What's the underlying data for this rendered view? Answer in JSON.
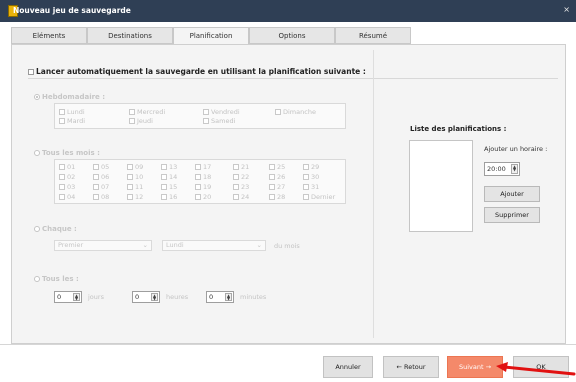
{
  "window": {
    "title": "Nouveau jeu de sauvegarde",
    "close_glyph": "×"
  },
  "tabs": [
    {
      "label": "Eléments"
    },
    {
      "label": "Destinations"
    },
    {
      "label": "Planification",
      "active": true
    },
    {
      "label": "Options"
    },
    {
      "label": "Résumé"
    }
  ],
  "auto_schedule": {
    "label": "Lancer automatiquement la sauvegarde en utilisant la planification suivante :",
    "checked": false
  },
  "weekly": {
    "label": "Hebdomadaire :",
    "days": [
      "Lundi",
      "Mercredi",
      "Vendredi",
      "Dimanche",
      "Mardi",
      "Jeudi",
      "Samedi"
    ]
  },
  "monthly": {
    "label": "Tous les mois :",
    "days": [
      "01",
      "05",
      "09",
      "13",
      "17",
      "21",
      "25",
      "29",
      "02",
      "06",
      "10",
      "14",
      "18",
      "22",
      "26",
      "30",
      "03",
      "07",
      "11",
      "15",
      "19",
      "23",
      "27",
      "31",
      "04",
      "08",
      "12",
      "16",
      "20",
      "24",
      "28",
      "Dernier"
    ]
  },
  "each": {
    "label": "Chaque :",
    "ordinal": "Premier",
    "weekday": "Lundi",
    "suffix": "du mois"
  },
  "every": {
    "label": "Tous les :",
    "days_value": "0",
    "days_unit": "jours",
    "hours_value": "0",
    "hours_unit": "heures",
    "minutes_value": "0",
    "minutes_unit": "minutes"
  },
  "schedule_list": {
    "title": "Liste des planifications :",
    "add_time_label": "Ajouter un horaire :",
    "time_value": "20:00",
    "add_button": "Ajouter",
    "remove_button": "Supprimer"
  },
  "footer": {
    "cancel": "Annuler",
    "back": "← Retour",
    "next": "Suivant →",
    "ok": "OK"
  },
  "colors": {
    "titlebar": "#2f3f55",
    "primary": "#f4896a",
    "annotation_arrow": "#e11111"
  },
  "icons": {
    "spinner": "up-down-arrows",
    "dropdown": "chevron-down"
  }
}
